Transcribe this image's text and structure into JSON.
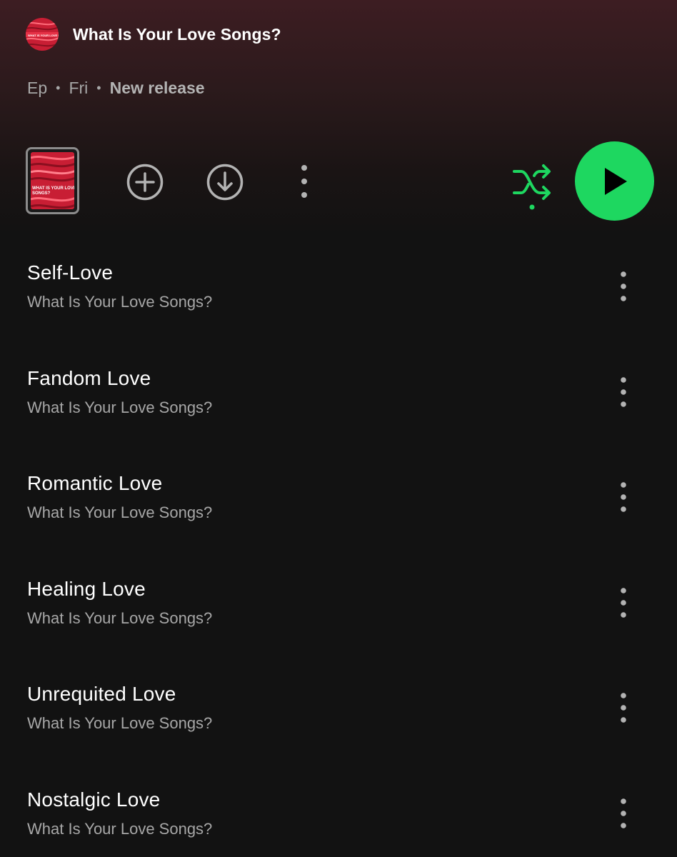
{
  "header": {
    "show_title": "What Is Your Love Songs?"
  },
  "meta": {
    "type": "Ep",
    "day": "Fri",
    "status": "New release"
  },
  "colors": {
    "accent": "#1ed760",
    "background": "#121212",
    "header_tint": "#3d1d22",
    "cover_red": "#d8243a"
  },
  "controls": {
    "thumbnail_text": "WHAT IS YOUR LOVE SONGS?",
    "icons": [
      "add-circle-icon",
      "download-circle-icon",
      "more-vertical-icon",
      "shuffle-icon",
      "play-icon"
    ]
  },
  "episodes": [
    {
      "title": "Self-Love",
      "subtitle": "What Is Your Love Songs?"
    },
    {
      "title": "Fandom Love",
      "subtitle": "What Is Your Love Songs?"
    },
    {
      "title": "Romantic Love",
      "subtitle": "What Is Your Love Songs?"
    },
    {
      "title": "Healing Love",
      "subtitle": "What Is Your Love Songs?"
    },
    {
      "title": "Unrequited Love",
      "subtitle": "What Is Your Love Songs?"
    },
    {
      "title": "Nostalgic Love",
      "subtitle": "What Is Your Love Songs?"
    }
  ]
}
